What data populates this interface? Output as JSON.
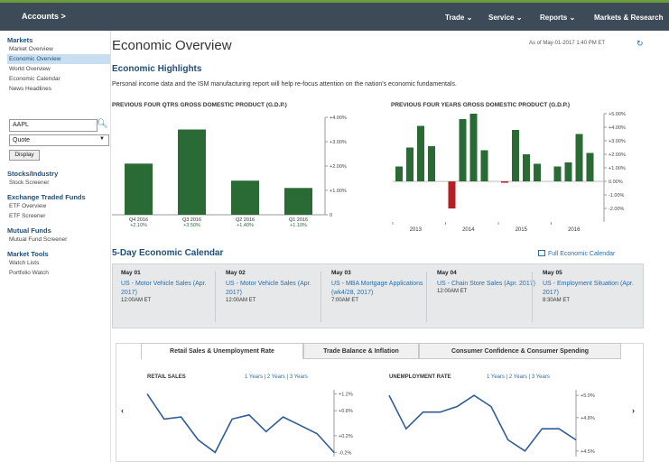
{
  "topbar": {
    "accounts": "Accounts >",
    "menus": [
      "Trade ⌄",
      "Service ⌄",
      "Reports ⌄",
      "Markets & Research"
    ]
  },
  "sidebar": {
    "sections": [
      {
        "heading": "Markets",
        "items": [
          "Market Overview",
          "Economic Overview",
          "World Overview",
          "Economic Calendar",
          "News Headlines"
        ],
        "selected": 1
      },
      {
        "heading": "Stocks/Industry",
        "items": [
          "Stock Screener"
        ]
      },
      {
        "heading": "Exchange Traded Funds",
        "items": [
          "ETF Overview",
          "ETF Screener"
        ]
      },
      {
        "heading": "Mutual Funds",
        "items": [
          "Mutual Fund Screener"
        ]
      },
      {
        "heading": "Market Tools",
        "items": [
          "Watch Lists",
          "Portfolio Watch"
        ]
      }
    ],
    "symbol_value": "AAPL",
    "quote_select": "Quote",
    "display_label": "Display"
  },
  "header": {
    "title": "Economic Overview",
    "as_of": "As of May-01-2017  1:40 PM ET"
  },
  "highlights": {
    "title": "Economic Highlights",
    "intro": "Personal income data and the ISM manufacturing report will help re-focus attention on the nation's economic fundamentals."
  },
  "chart_data": [
    {
      "type": "bar",
      "title": "PREVIOUS FOUR QTRS GROSS DOMESTIC PRODUCT (G.D.P.)",
      "categories": [
        "Q4 2016",
        "Q3 2016",
        "Q2 2016",
        "Q1 2016"
      ],
      "values": [
        2.1,
        3.5,
        1.4,
        1.1
      ],
      "value_labels": [
        "+2.10%",
        "+3.50%",
        "+1.40%",
        "+1.10%"
      ],
      "ylim": [
        0,
        4
      ],
      "y_ticks": [
        "+4.00%",
        "+3.00%",
        "+2.00%",
        "+1.00%",
        "0"
      ],
      "color": "#2a6b35"
    },
    {
      "type": "bar",
      "title": "PREVIOUS FOUR YEARS GROSS DOMESTIC PRODUCT (G.D.P.)",
      "x_tick_labels": [
        "2013",
        "2014",
        "2015",
        "2016"
      ],
      "values": [
        1.1,
        2.5,
        4.1,
        2.6,
        -2.0,
        4.6,
        5.0,
        2.3,
        -0.1,
        3.8,
        2.0,
        1.3,
        1.1,
        1.4,
        3.5,
        2.1
      ],
      "ylim": [
        -3,
        5
      ],
      "y_ticks": [
        "+5.00%",
        "+4.00%",
        "+3.00%",
        "+2.00%",
        "+1.00%",
        "0.00%",
        "-1.00%",
        "-2.00%"
      ],
      "positive_color": "#2a6b35",
      "negative_color": "#b51f24"
    }
  ],
  "calendar": {
    "title": "5-Day Economic Calendar",
    "full_link": "Full Economic Calendar",
    "days": [
      {
        "date": "May 01",
        "event": "US - Motor Vehicle Sales (Apr. 2017)",
        "time": "12:00AM ET"
      },
      {
        "date": "May 02",
        "event": "US - Motor Vehicle Sales (Apr. 2017)",
        "time": "12:00AM ET"
      },
      {
        "date": "May 03",
        "event": "US - MBA Mortgage Applications (wk4/28, 2017)",
        "time": "7:00AM ET"
      },
      {
        "date": "May 04",
        "event": "US - Chain Store Sales (Apr. 2017)",
        "time": "12:00AM ET"
      },
      {
        "date": "May 05",
        "event": "US - Employment Situation (Apr. 2017)",
        "time": "8:30AM ET"
      }
    ]
  },
  "tabs": [
    "Retail Sales & Unemployment Rate",
    "Trade Balance & Inflation",
    "Consumer Confidence & Consumer Spending"
  ],
  "mini_charts": [
    {
      "title": "RETAIL SALES",
      "links": "1 Years | 2 Years | 3 Years",
      "y_ticks": [
        "+1.2%",
        "+0.8%",
        "+0.2%",
        "-0.2%"
      ],
      "values": [
        1.2,
        0.6,
        0.65,
        0.1,
        -0.2,
        0.6,
        0.7,
        0.3,
        0.65,
        0.45,
        0.25,
        -0.2
      ],
      "ylim": [
        -0.3,
        1.3
      ]
    },
    {
      "title": "UNEMPLOYMENT RATE",
      "links": "1 Years | 2 Years | 3 Years",
      "y_ticks": [
        "+5.0%",
        "+4.8%",
        "+4.5%"
      ],
      "values": [
        5.0,
        4.7,
        4.85,
        4.85,
        4.9,
        5.0,
        4.9,
        4.6,
        4.5,
        4.7,
        4.7,
        4.6
      ],
      "ylim": [
        4.45,
        5.05
      ]
    }
  ]
}
